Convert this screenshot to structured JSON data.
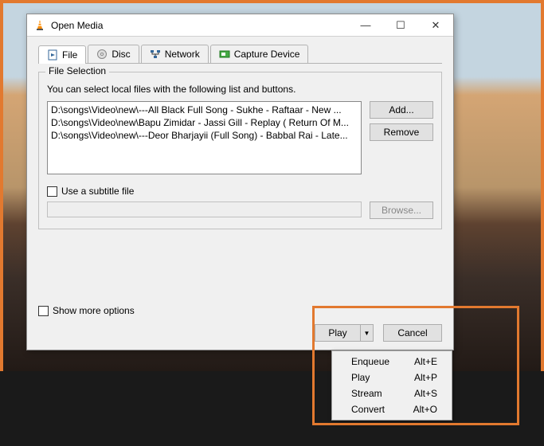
{
  "window": {
    "title": "Open Media"
  },
  "tabs": {
    "file": "File",
    "disc": "Disc",
    "network": "Network",
    "capture": "Capture Device"
  },
  "file_selection": {
    "legend": "File Selection",
    "help": "You can select local files with the following list and buttons.",
    "files": [
      "D:\\songs\\Video\\new\\---All Black Full Song - Sukhe - Raftaar -  New ...",
      "D:\\songs\\Video\\new\\Bapu Zimidar - Jassi Gill - Replay ( Return Of M...",
      "D:\\songs\\Video\\new\\---Deor Bharjayii (Full Song) - Babbal Rai - Late..."
    ],
    "add": "Add...",
    "remove": "Remove"
  },
  "subtitle": {
    "checkbox_label": "Use a subtitle file",
    "browse": "Browse..."
  },
  "show_more": "Show more options",
  "footer": {
    "play": "Play",
    "cancel": "Cancel"
  },
  "menu": {
    "enqueue": {
      "label": "Enqueue",
      "shortcut": "Alt+E"
    },
    "play": {
      "label": "Play",
      "shortcut": "Alt+P"
    },
    "stream": {
      "label": "Stream",
      "shortcut": "Alt+S"
    },
    "convert": {
      "label": "Convert",
      "shortcut": "Alt+O"
    }
  }
}
